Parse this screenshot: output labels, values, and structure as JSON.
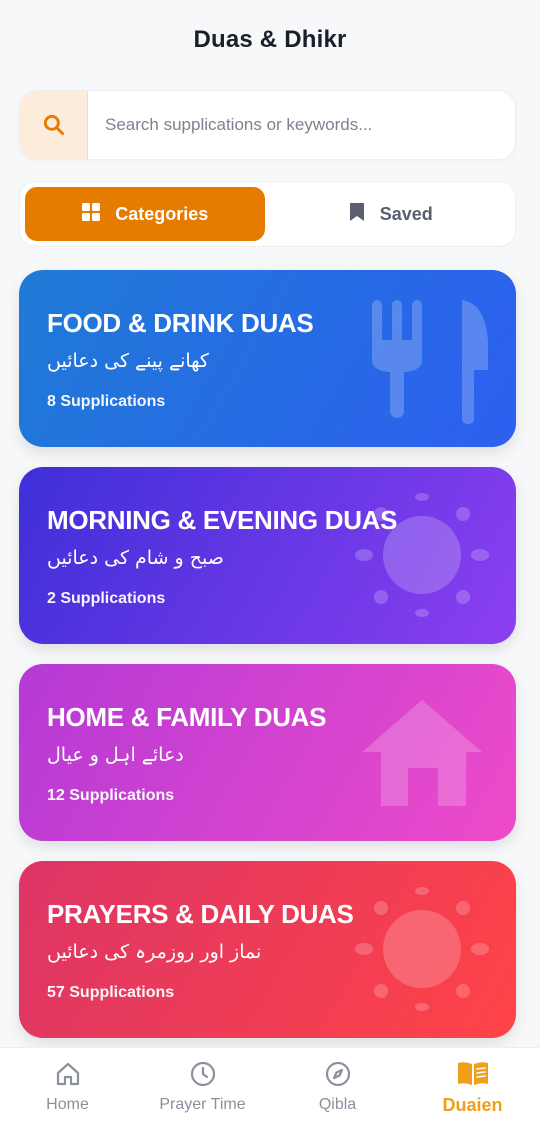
{
  "header": {
    "title": "Duas & Dhikr"
  },
  "search": {
    "placeholder": "Search supplications or keywords...",
    "icon": "search-icon"
  },
  "tabs": [
    {
      "label": "Categories",
      "icon": "grid-icon",
      "active": true
    },
    {
      "label": "Saved",
      "icon": "bookmark-icon",
      "active": false
    }
  ],
  "categories": [
    {
      "title": "FOOD & DRINK DUAS",
      "urdu": "کھانے پینے کی دعائیں",
      "count": "8 Supplications",
      "icon": "utensils-icon"
    },
    {
      "title": "MORNING & EVENING DUAS",
      "urdu": "صبح و شام کی دعائیں",
      "count": "2 Supplications",
      "icon": "sun-icon"
    },
    {
      "title": "HOME & FAMILY DUAS",
      "urdu": "دعائے اہل و عیال",
      "count": "12 Supplications",
      "icon": "house-icon"
    },
    {
      "title": "PRAYERS & DAILY DUAS",
      "urdu": "نماز اور روزمرہ کی دعائیں",
      "count": "57 Supplications",
      "icon": "sun-icon"
    }
  ],
  "nav": [
    {
      "label": "Home",
      "icon": "home-icon",
      "active": false
    },
    {
      "label": "Prayer Time",
      "icon": "clock-icon",
      "active": false
    },
    {
      "label": "Qibla",
      "icon": "compass-icon",
      "active": false
    },
    {
      "label": "Duaien",
      "icon": "book-icon",
      "active": true
    }
  ],
  "colors": {
    "accent": "#e57c00",
    "nav_active": "#f0a018",
    "food_gradient": [
      "#1f7ad6",
      "#2d5ff0"
    ],
    "morning_gradient": [
      "#3e2fd8",
      "#8c3ff0"
    ],
    "home_gradient": [
      "#b53ad6",
      "#ee4bc9"
    ],
    "prayers_gradient": [
      "#dc3566",
      "#ff4347"
    ]
  }
}
